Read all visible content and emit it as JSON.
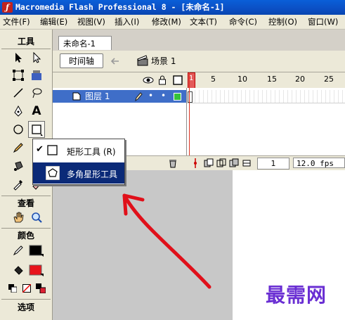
{
  "window": {
    "title": "Macromedia Flash Professional 8 - [未命名-1]"
  },
  "menubar": {
    "items": [
      "文件(F)",
      "编辑(E)",
      "视图(V)",
      "插入(I)",
      "修改(M)",
      "文本(T)",
      "命令(C)",
      "控制(O)",
      "窗口(W)"
    ]
  },
  "tools": {
    "header": "工具",
    "view_header": "查看",
    "colors_header": "颜色",
    "options_header": "选项",
    "stroke_color": "#000000",
    "fill_color": "#e8141b"
  },
  "document": {
    "tab": "未命名-1",
    "timeline_button": "时间轴",
    "scene_label": "场景 1"
  },
  "timeline": {
    "frame_numbers": [
      "1",
      "5",
      "10",
      "15",
      "20",
      "25"
    ],
    "layer_name": "图层 1",
    "current_frame": "1",
    "fps": "12.0 fps"
  },
  "flyout": {
    "items": [
      {
        "label": "矩形工具 (R)",
        "checked": true,
        "icon": "rectangle-icon"
      },
      {
        "label": "多角星形工具",
        "checked": false,
        "icon": "polystar-icon"
      }
    ]
  },
  "annotation": {
    "arrow_color": "#e0101a"
  },
  "watermark": {
    "text": "最需网"
  }
}
